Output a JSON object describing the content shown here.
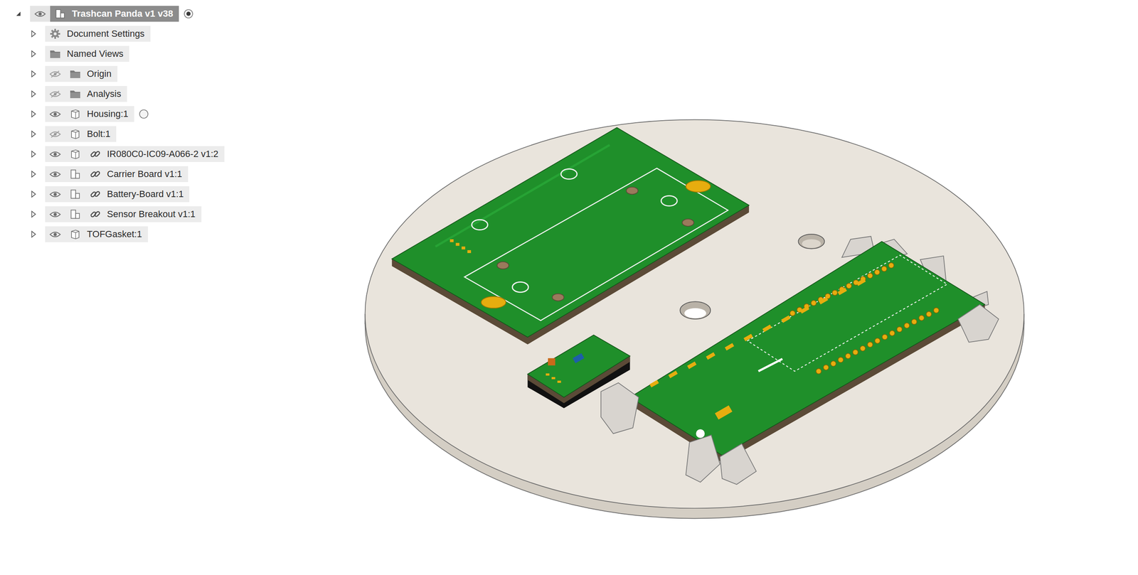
{
  "browser": {
    "root": {
      "label": "Trashcan Panda v1 v38",
      "kind": "assembly",
      "expanded": true,
      "visibility": "shown",
      "selected": true,
      "activate": "on"
    },
    "items": [
      {
        "label": "Document Settings",
        "kind": "settings",
        "visibility": "none",
        "linked": false,
        "expanded": false,
        "selected": false,
        "activate": "none"
      },
      {
        "label": "Named Views",
        "kind": "folder",
        "visibility": "none",
        "linked": false,
        "expanded": false,
        "selected": false,
        "activate": "none"
      },
      {
        "label": "Origin",
        "kind": "folder",
        "visibility": "hidden",
        "linked": false,
        "expanded": false,
        "selected": false,
        "activate": "none"
      },
      {
        "label": "Analysis",
        "kind": "folder",
        "visibility": "hidden",
        "linked": false,
        "expanded": false,
        "selected": false,
        "activate": "none"
      },
      {
        "label": "Housing:1",
        "kind": "body",
        "visibility": "shown",
        "linked": false,
        "expanded": false,
        "selected": false,
        "activate": "off"
      },
      {
        "label": "Bolt:1",
        "kind": "body",
        "visibility": "hidden",
        "linked": false,
        "expanded": false,
        "selected": false,
        "activate": "none"
      },
      {
        "label": "IR080C0-IC09-A066-2 v1:2",
        "kind": "body",
        "visibility": "shown",
        "linked": true,
        "expanded": false,
        "selected": false,
        "activate": "none"
      },
      {
        "label": "Carrier Board v1:1",
        "kind": "component",
        "visibility": "shown",
        "linked": true,
        "expanded": false,
        "selected": false,
        "activate": "none"
      },
      {
        "label": "Battery-Board v1:1",
        "kind": "component",
        "visibility": "shown",
        "linked": true,
        "expanded": false,
        "selected": false,
        "activate": "none"
      },
      {
        "label": "Sensor Breakout v1:1",
        "kind": "component",
        "visibility": "shown",
        "linked": true,
        "expanded": false,
        "selected": false,
        "activate": "none"
      },
      {
        "label": "TOFGasket:1",
        "kind": "body",
        "visibility": "shown",
        "linked": false,
        "expanded": false,
        "selected": false,
        "activate": "none"
      }
    ]
  }
}
